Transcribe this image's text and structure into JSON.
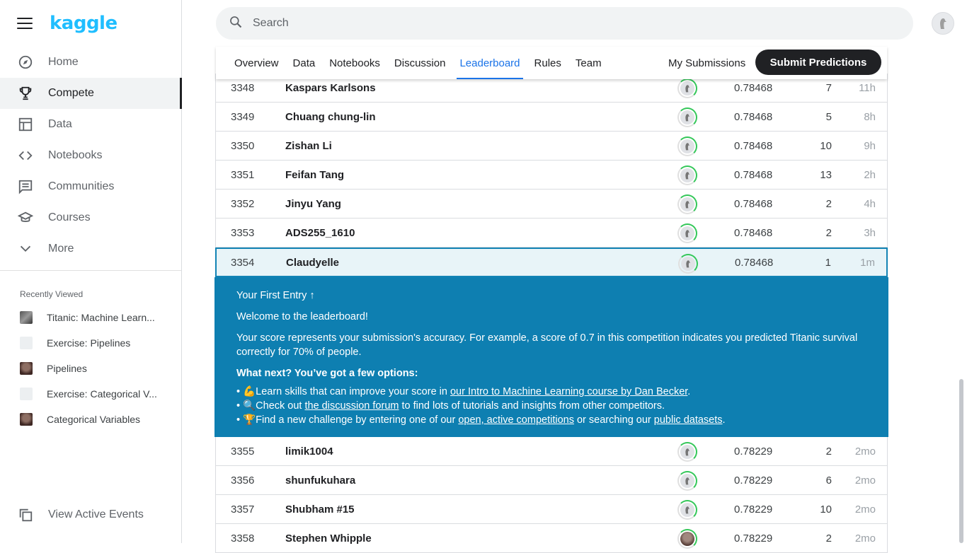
{
  "brand": {
    "logo": "kaggle"
  },
  "sidebar": {
    "items": [
      {
        "label": "Home",
        "icon": "compass-icon"
      },
      {
        "label": "Compete",
        "icon": "trophy-icon",
        "active": true
      },
      {
        "label": "Data",
        "icon": "table-icon"
      },
      {
        "label": "Notebooks",
        "icon": "code-icon"
      },
      {
        "label": "Communities",
        "icon": "comment-icon"
      },
      {
        "label": "Courses",
        "icon": "school-icon"
      },
      {
        "label": "More",
        "icon": "chevron-down-icon"
      }
    ],
    "recent_title": "Recently Viewed",
    "recent": [
      {
        "label": "Titanic: Machine Learn..."
      },
      {
        "label": "Exercise: Pipelines"
      },
      {
        "label": "Pipelines"
      },
      {
        "label": "Exercise: Categorical V..."
      },
      {
        "label": "Categorical Variables"
      }
    ],
    "events_label": "View Active Events"
  },
  "search": {
    "placeholder": "Search"
  },
  "tabs": {
    "items": [
      "Overview",
      "Data",
      "Notebooks",
      "Discussion",
      "Leaderboard",
      "Rules",
      "Team"
    ],
    "selected": "Leaderboard",
    "my_submissions": "My Submissions",
    "submit": "Submit Predictions"
  },
  "leaderboard": {
    "rows_before": [
      {
        "rank": "3348",
        "name": "Kaspars Karlsons",
        "score": "0.78468",
        "entries": "7",
        "last": "11h"
      },
      {
        "rank": "3349",
        "name": "Chuang chung-lin",
        "score": "0.78468",
        "entries": "5",
        "last": "8h"
      },
      {
        "rank": "3350",
        "name": "Zishan Li",
        "score": "0.78468",
        "entries": "10",
        "last": "9h"
      },
      {
        "rank": "3351",
        "name": "Feifan Tang",
        "score": "0.78468",
        "entries": "13",
        "last": "2h"
      },
      {
        "rank": "3352",
        "name": "Jinyu Yang",
        "score": "0.78468",
        "entries": "2",
        "last": "4h"
      },
      {
        "rank": "3353",
        "name": "ADS255_1610",
        "score": "0.78468",
        "entries": "2",
        "last": "3h"
      }
    ],
    "me": {
      "rank": "3354",
      "name": "Claudyelle",
      "score": "0.78468",
      "entries": "1",
      "last": "1m"
    },
    "rows_after": [
      {
        "rank": "3355",
        "name": "limik1004",
        "score": "0.78229",
        "entries": "2",
        "last": "2mo"
      },
      {
        "rank": "3356",
        "name": "shunfukuhara",
        "score": "0.78229",
        "entries": "6",
        "last": "2mo"
      },
      {
        "rank": "3357",
        "name": "Shubham #15",
        "score": "0.78229",
        "entries": "10",
        "last": "2mo"
      },
      {
        "rank": "3358",
        "name": "Stephen Whipple",
        "score": "0.78229",
        "entries": "2",
        "last": "2mo"
      }
    ]
  },
  "info": {
    "title": "Your First Entry ↑",
    "welcome": "Welcome to the leaderboard!",
    "score_text": "Your score represents your submission's accuracy. For example, a score of 0.7 in this competition indicates you predicted Titanic survival correctly for 70% of people.",
    "next_title": "What next? You’ve got a few options:",
    "opt1_pre": "💪Learn skills that can improve your score in ",
    "opt1_link": "our Intro to Machine Learning course by Dan Becker",
    "opt1_post": ".",
    "opt2_pre": "🔍Check out ",
    "opt2_link": "the discussion forum",
    "opt2_post": " to find lots of tutorials and insights from other competitors.",
    "opt3_pre": "🏆Find a new challenge by entering one of our ",
    "opt3_link1": "open, active competitions",
    "opt3_mid": " or searching our ",
    "opt3_link2": "public datasets",
    "opt3_post": "."
  },
  "colors": {
    "brand": "#20beff",
    "accent": "#1a73e8",
    "banner": "#0e7fb1",
    "highlight_row": "#e8f4f8"
  }
}
